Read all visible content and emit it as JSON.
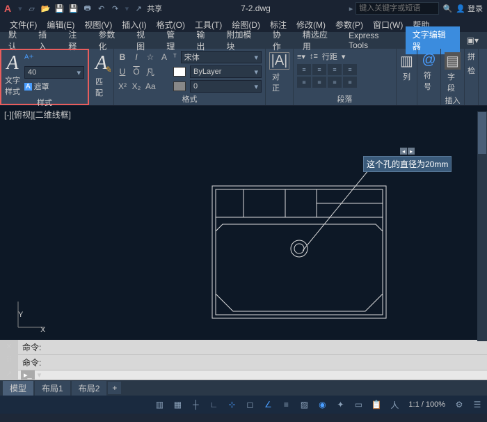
{
  "title": {
    "filename": "7-2.dwg",
    "share": "共享",
    "search_placeholder": "键入关键字或短语",
    "login": "登录"
  },
  "menu": [
    "文件(F)",
    "编辑(E)",
    "视图(V)",
    "插入(I)",
    "格式(O)",
    "工具(T)",
    "绘图(D)",
    "标注",
    "修改(M)",
    "参数(P)",
    "窗口(W)",
    "帮助"
  ],
  "tabs": [
    "默认",
    "插入",
    "注释",
    "参数化",
    "视图",
    "管理",
    "输出",
    "附加模块",
    "协作",
    "精选应用",
    "Express Tools",
    "文字编辑器"
  ],
  "active_tab": 11,
  "ribbon": {
    "style": {
      "label": "样式",
      "size": "40",
      "text": "文字",
      "style_btn": "样式",
      "mask": "遮罩"
    },
    "match": {
      "label": "匹配",
      "panel": "格式"
    },
    "format": {
      "font": "宋体",
      "layer": "ByLayer",
      "buttons": [
        "B",
        "I",
        "☆",
        "A",
        "U",
        "Ō",
        "凡",
        "X²",
        "X₂",
        "Aa"
      ]
    },
    "align": {
      "label": "对正"
    },
    "para": {
      "label": "段落",
      "lh": "行距"
    },
    "col": {
      "label": "列"
    },
    "sym": {
      "label": "符号"
    },
    "field": {
      "label": "字段"
    },
    "insert": {
      "label": "插入"
    },
    "spell": {
      "label": "拼",
      "check": "检"
    }
  },
  "canvas": {
    "viewlabel": "[-][俯视][二维线框]",
    "annotation": "这个孔的直径为20mm"
  },
  "cmd": {
    "prompt1": "命令:",
    "prompt2": "命令:"
  },
  "layout": {
    "tabs": [
      "模型",
      "布局1",
      "布局2"
    ],
    "active": 0
  },
  "status": {
    "scale": "1:1 / 100%"
  }
}
